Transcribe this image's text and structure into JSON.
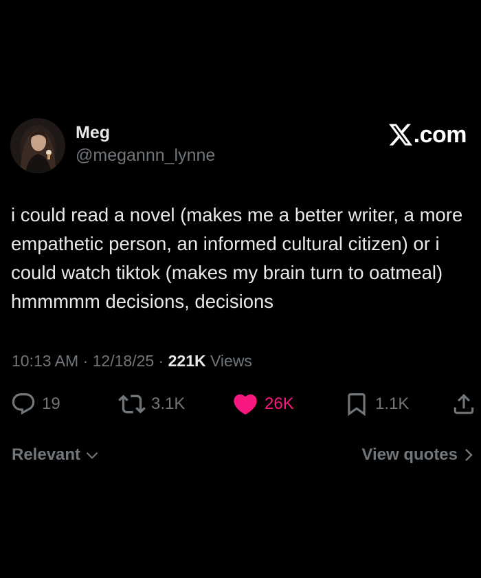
{
  "author": {
    "display_name": "Meg",
    "handle": "@megannn_lynne",
    "avatar_icon": "avatar-photo"
  },
  "brand": {
    "label": ".com",
    "icon": "x-logo-icon"
  },
  "tweet": {
    "text": "i could read a novel (makes me a better writer, a more empathetic person, an informed cultural citizen) or i could watch tiktok (makes my brain turn to oatmeal) hmmmmm decisions, decisions",
    "time": "10:13 AM",
    "separator": " · ",
    "date": "12/18/25",
    "views_count": "221K",
    "views_label": "Views"
  },
  "actions": {
    "replies": "19",
    "reposts": "3.1K",
    "likes": "26K",
    "bookmarks": "1.1K",
    "like_color": "#f91880"
  },
  "footer": {
    "sort_label": "Relevant",
    "quotes_label": "View quotes"
  }
}
